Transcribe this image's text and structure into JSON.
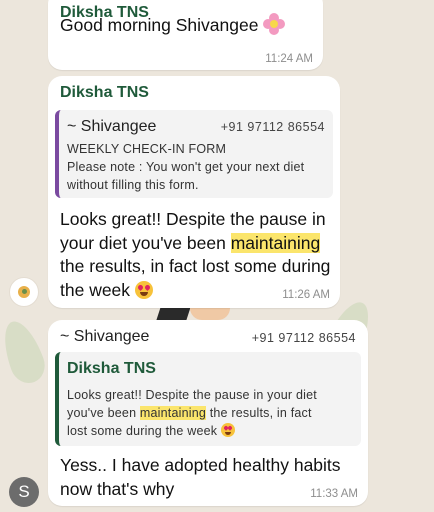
{
  "messages": [
    {
      "sender": "Diksha TNS",
      "text": "Good morning Shivangee",
      "emoji": "flower-emoji",
      "time": "11:24 AM"
    },
    {
      "sender": "Diksha TNS",
      "quoted": {
        "author": "~ Shivangee",
        "phone": "+91 97112 86554",
        "lines": [
          "WEEKLY CHECK-IN FORM",
          "Please note : You won't get your next diet",
          "without filling this form."
        ]
      },
      "text_lines": [
        "Looks great!! Despite the pause in",
        "your diet you've been ",
        "maintaining",
        "the results, in fact lost some during",
        "the week"
      ],
      "emoji": "heart-eyes-emoji",
      "time": "11:26 AM"
    },
    {
      "sender": "~ Shivangee",
      "phone": "+91 97112 86554",
      "quoted": {
        "author": "Diksha TNS",
        "lines": [
          "Looks great!! Despite the pause in your diet",
          "you've been ",
          "maintaining",
          " the results, in fact",
          "lost some during the week"
        ]
      },
      "text_lines": [
        "Yess.. I have adopted healthy habits",
        "now that's why"
      ],
      "time": "11:33 AM",
      "avatar_initial": "S"
    }
  ],
  "colors": {
    "highlight": "#fbe56c",
    "sender_name": "#1f5a3a",
    "quote_bar": "#7a4aa0",
    "chat_background": "#ece6dc"
  }
}
